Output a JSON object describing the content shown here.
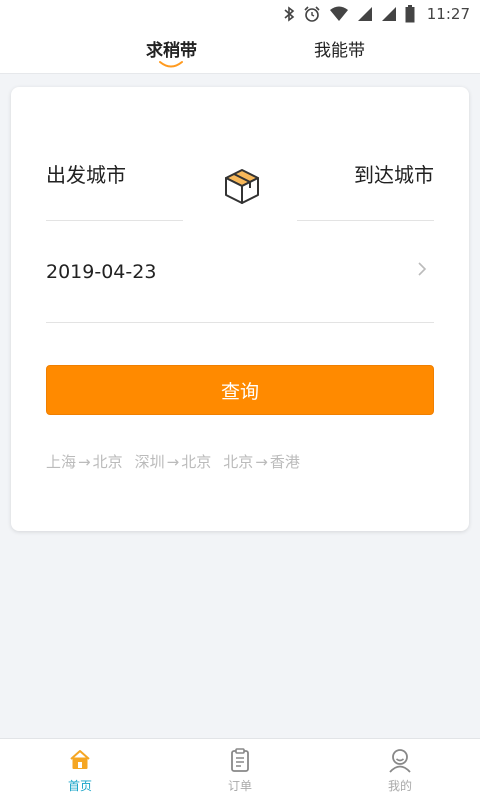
{
  "status_bar": {
    "time": "11:27",
    "icons": [
      "bluetooth-icon",
      "alarm-icon",
      "wifi-icon",
      "signal-icon",
      "signal-icon",
      "battery-icon"
    ]
  },
  "top_tabs": {
    "items": [
      {
        "label": "求稍带",
        "active": true
      },
      {
        "label": "我能带",
        "active": false
      }
    ]
  },
  "search": {
    "from_city": "出发城市",
    "to_city": "到达城市",
    "date": "2019-04-23",
    "query_button": "查询",
    "recent_routes": [
      {
        "from": "上海",
        "arrow": "→",
        "to": "北京"
      },
      {
        "from": "深圳",
        "arrow": "→",
        "to": "北京"
      },
      {
        "from": "北京",
        "arrow": "→",
        "to": "香港"
      }
    ]
  },
  "bottom_nav": {
    "items": [
      {
        "label": "首页",
        "icon": "home-icon",
        "active": true
      },
      {
        "label": "订单",
        "icon": "clipboard-icon",
        "active": false
      },
      {
        "label": "我的",
        "icon": "user-icon",
        "active": false
      }
    ]
  },
  "colors": {
    "accent": "#ff8a00",
    "nav_active": "#18a4c8",
    "background": "#f2f4f7"
  }
}
